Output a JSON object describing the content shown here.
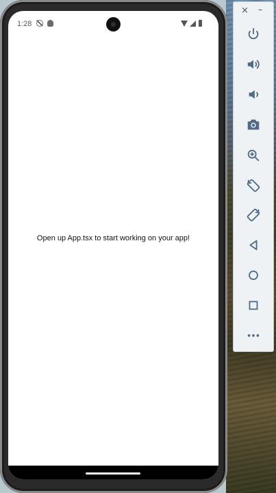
{
  "status_bar": {
    "time": "1:28"
  },
  "main": {
    "message": "Open up App.tsx to start working on your app!"
  },
  "toolbar": {
    "close_glyph": "×",
    "minimize_glyph": "–",
    "buttons": [
      "power-icon",
      "volume-up-icon",
      "volume-down-icon",
      "camera-icon",
      "zoom-icon",
      "rotate-left-icon",
      "rotate-right-icon",
      "back-icon",
      "home-icon",
      "overview-icon",
      "more-icon"
    ]
  },
  "colors": {
    "toolbar_icon": "#4f6b86",
    "toolbar_bg": "#eef2f5",
    "screen_bg": "#ffffff",
    "nav_bar": "#000000"
  }
}
